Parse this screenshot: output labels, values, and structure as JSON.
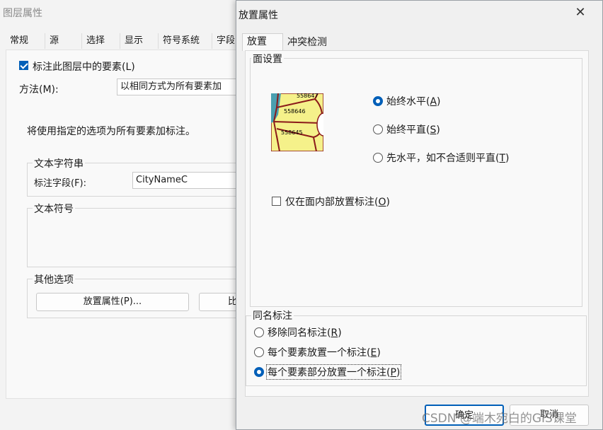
{
  "background_window": {
    "title": "图层属性",
    "tabs": [
      "常规",
      "源",
      "选择",
      "显示",
      "符号系统",
      "字段"
    ],
    "label_checkbox": "标注此图层中的要素(L)",
    "method_label": "方法(M):",
    "method_value": "以相同方式为所有要素加",
    "info_text": "将使用指定的选项为所有要素加标注。",
    "text_string_group": "文本字符串",
    "label_field_label": "标注字段(F):",
    "label_field_value": "CityNameC",
    "text_symbol_group": "文本符号",
    "other_options_group": "其他选项",
    "placement_button": "放置属性(P)...",
    "scale_button_partial": "比"
  },
  "dialog": {
    "title": "放置属性",
    "close_icon": "close-icon",
    "tabs": [
      "放置",
      "冲突检测"
    ],
    "active_tab": "放置",
    "polygon_settings": {
      "group_label": "面设置",
      "preview_labels": [
        "558647",
        "558646",
        "558645"
      ],
      "options": [
        {
          "label": "始终水平(",
          "key": "A",
          "selected": true
        },
        {
          "label": "始终平直(",
          "key": "S",
          "selected": false
        },
        {
          "label": "先水平，如不合适则平直(",
          "key": "T",
          "selected": false
        }
      ],
      "inside_checkbox": {
        "label": "仅在面内部放置标注(",
        "key": "O",
        "checked": false
      }
    },
    "duplicate_labels": {
      "group_label": "同名标注",
      "options": [
        {
          "label": "移除同名标注(",
          "key": "R",
          "selected": false
        },
        {
          "label": "每个要素放置一个标注(",
          "key": "E",
          "selected": false
        },
        {
          "label": "每个要素部分放置一个标注(",
          "key": "P",
          "selected": true
        }
      ]
    },
    "ok_button": "确定",
    "cancel_button": "取消"
  },
  "watermark": "CSDN @端木宛白的GIS课堂",
  "colors": {
    "accent": "#005fb8",
    "preview_fill": "#f5f18a",
    "preview_border": "#8b1a1a",
    "preview_water": "#4a9fb0"
  }
}
